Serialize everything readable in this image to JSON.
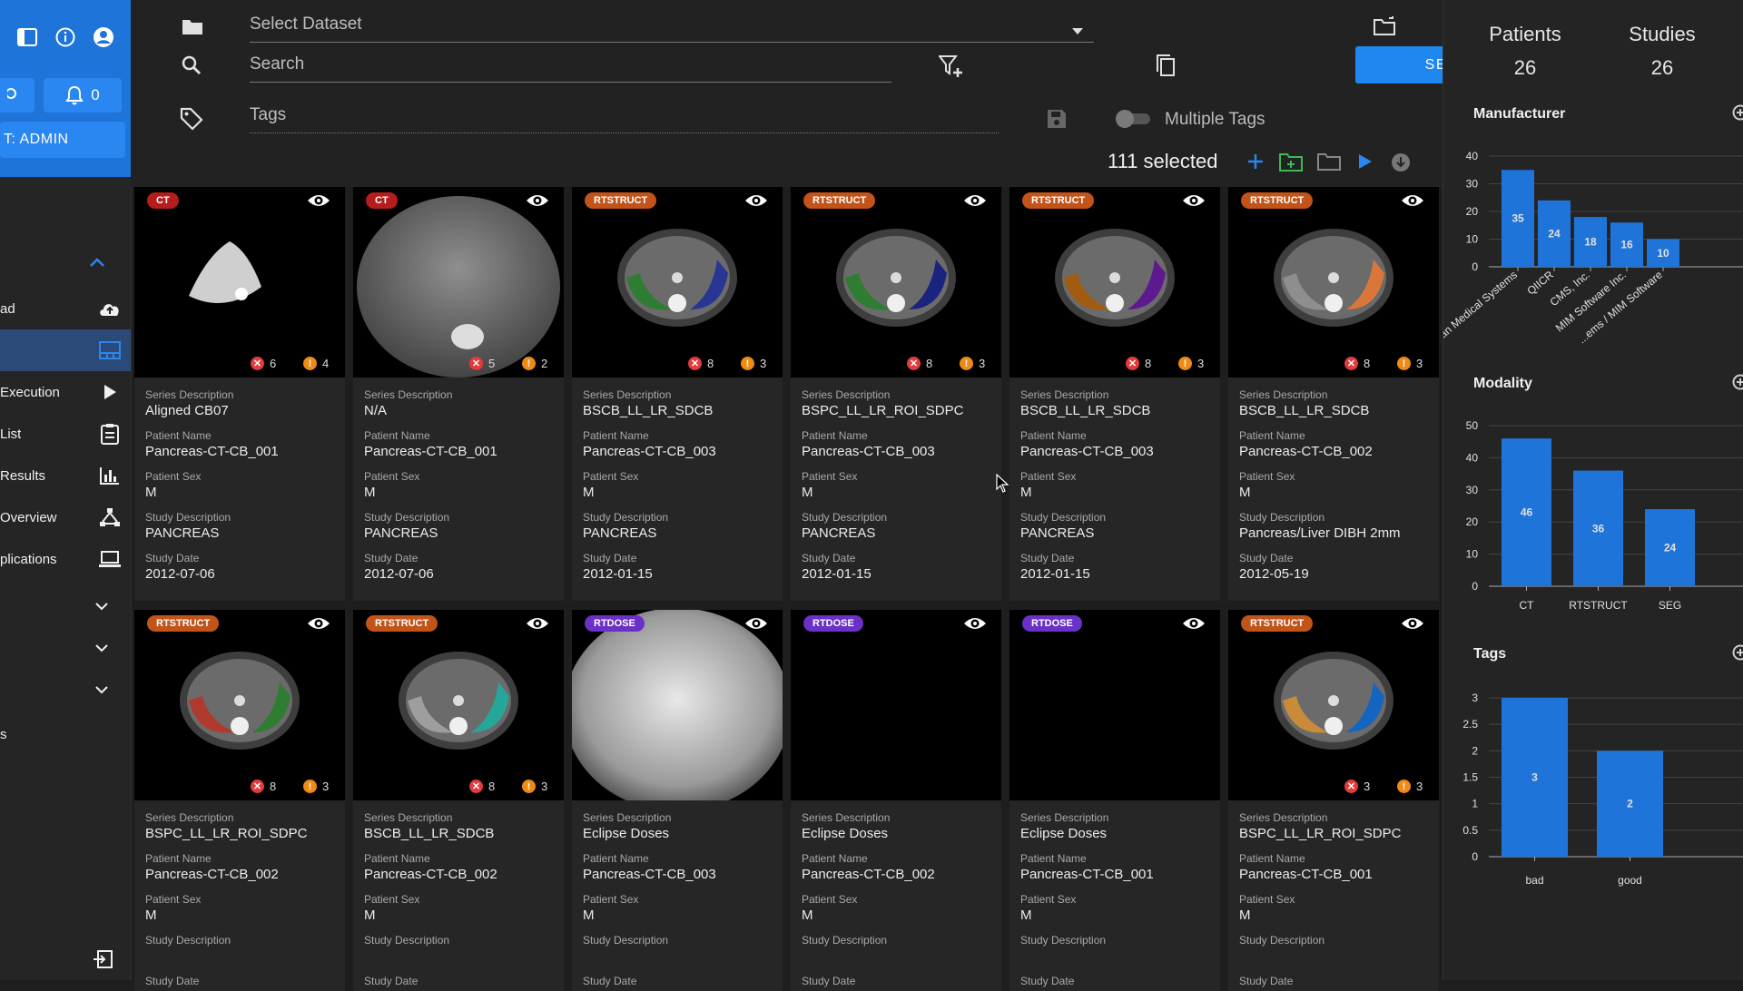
{
  "sidebar": {
    "notif_count": "0",
    "role_label": "T: ADMIN",
    "nav": [
      {
        "label": "ad",
        "icon": "cloud-upload-icon"
      },
      {
        "label": "",
        "icon": "browse-grid-icon"
      },
      {
        "label": "Execution",
        "icon": "play-icon"
      },
      {
        "label": "List",
        "icon": "clipboard-icon"
      },
      {
        "label": "Results",
        "icon": "bar-chart-icon"
      },
      {
        "label": "Overview",
        "icon": "network-icon"
      },
      {
        "label": "plications",
        "icon": "laptop-icon"
      }
    ],
    "lone_label": "s"
  },
  "toolbar": {
    "dataset_placeholder": "Select Dataset",
    "search_placeholder": "Search",
    "search_button": "SEARCH",
    "tags_placeholder": "Tags",
    "multiple_tags_label": "Multiple Tags",
    "selected_text": "111 selected"
  },
  "cards": [
    {
      "modality": "CT",
      "errors": "6",
      "warnings": "4",
      "series_description": "Aligned CB07",
      "patient_name": "Pancreas-CT-CB_001",
      "patient_sex": "M",
      "study_description": "PANCREAS",
      "study_date": "2012-07-06"
    },
    {
      "modality": "CT",
      "errors": "5",
      "warnings": "2",
      "series_description": "N/A",
      "patient_name": "Pancreas-CT-CB_001",
      "patient_sex": "M",
      "study_description": "PANCREAS",
      "study_date": "2012-07-06"
    },
    {
      "modality": "RTSTRUCT",
      "errors": "8",
      "warnings": "3",
      "series_description": "BSCB_LL_LR_SDCB",
      "patient_name": "Pancreas-CT-CB_003",
      "patient_sex": "M",
      "study_description": "PANCREAS",
      "study_date": "2012-01-15"
    },
    {
      "modality": "RTSTRUCT",
      "errors": "8",
      "warnings": "3",
      "series_description": "BSPC_LL_LR_ROI_SDPC",
      "patient_name": "Pancreas-CT-CB_003",
      "patient_sex": "M",
      "study_description": "PANCREAS",
      "study_date": "2012-01-15"
    },
    {
      "modality": "RTSTRUCT",
      "errors": "8",
      "warnings": "3",
      "series_description": "BSCB_LL_LR_SDCB",
      "patient_name": "Pancreas-CT-CB_003",
      "patient_sex": "M",
      "study_description": "PANCREAS",
      "study_date": "2012-01-15"
    },
    {
      "modality": "RTSTRUCT",
      "errors": "8",
      "warnings": "3",
      "series_description": "BSCB_LL_LR_SDCB",
      "patient_name": "Pancreas-CT-CB_002",
      "patient_sex": "M",
      "study_description": "Pancreas/Liver DIBH 2mm",
      "study_date": "2012-05-19"
    },
    {
      "modality": "RTSTRUCT",
      "errors": "8",
      "warnings": "3",
      "series_description": "BSPC_LL_LR_ROI_SDPC",
      "patient_name": "Pancreas-CT-CB_002",
      "patient_sex": "M",
      "study_description": "",
      "study_date": ""
    },
    {
      "modality": "RTSTRUCT",
      "errors": "8",
      "warnings": "3",
      "series_description": "BSCB_LL_LR_SDCB",
      "patient_name": "Pancreas-CT-CB_002",
      "patient_sex": "M",
      "study_description": "",
      "study_date": ""
    },
    {
      "modality": "RTDOSE",
      "errors": "",
      "warnings": "",
      "series_description": "Eclipse Doses",
      "patient_name": "Pancreas-CT-CB_003",
      "patient_sex": "M",
      "study_description": "",
      "study_date": ""
    },
    {
      "modality": "RTDOSE",
      "errors": "",
      "warnings": "",
      "series_description": "Eclipse Doses",
      "patient_name": "Pancreas-CT-CB_002",
      "patient_sex": "M",
      "study_description": "",
      "study_date": ""
    },
    {
      "modality": "RTDOSE",
      "errors": "",
      "warnings": "",
      "series_description": "Eclipse Doses",
      "patient_name": "Pancreas-CT-CB_001",
      "patient_sex": "M",
      "study_description": "",
      "study_date": ""
    },
    {
      "modality": "RTSTRUCT",
      "errors": "3",
      "warnings": "3",
      "series_description": "BSPC_LL_LR_ROI_SDPC",
      "patient_name": "Pancreas-CT-CB_001",
      "patient_sex": "M",
      "study_description": "",
      "study_date": ""
    }
  ],
  "field_labels": {
    "series_description": "Series Description",
    "patient_name": "Patient Name",
    "patient_sex": "Patient Sex",
    "study_description": "Study Description",
    "study_date": "Study Date"
  },
  "summary": {
    "patients_label": "Patients",
    "patients_value": "26",
    "studies_label": "Studies",
    "studies_value": "26"
  },
  "chart_data": [
    {
      "type": "bar",
      "title": "Manufacturer",
      "categories": [
        "...an Medical Systems",
        "QIICR",
        "CMS, Inc.",
        "MIM Software Inc.",
        "...ems / MIM Software"
      ],
      "values": [
        35,
        24,
        18,
        16,
        10
      ],
      "ylim": [
        0,
        40
      ],
      "yticks": [
        0,
        10,
        20,
        30,
        40
      ],
      "color": "#1f74d9"
    },
    {
      "type": "bar",
      "title": "Modality",
      "categories": [
        "CT",
        "RTSTRUCT",
        "SEG"
      ],
      "values": [
        46,
        36,
        24
      ],
      "ylim": [
        0,
        50
      ],
      "yticks": [
        0,
        10,
        20,
        30,
        40,
        50
      ],
      "color": "#1f74d9"
    },
    {
      "type": "bar",
      "title": "Tags",
      "categories": [
        "bad",
        "good"
      ],
      "values": [
        3,
        2
      ],
      "ylim": [
        0,
        3
      ],
      "yticks": [
        "0",
        "0.5",
        "1",
        "1.5",
        "2",
        "2.5",
        "3"
      ],
      "color": "#1f74d9"
    }
  ]
}
